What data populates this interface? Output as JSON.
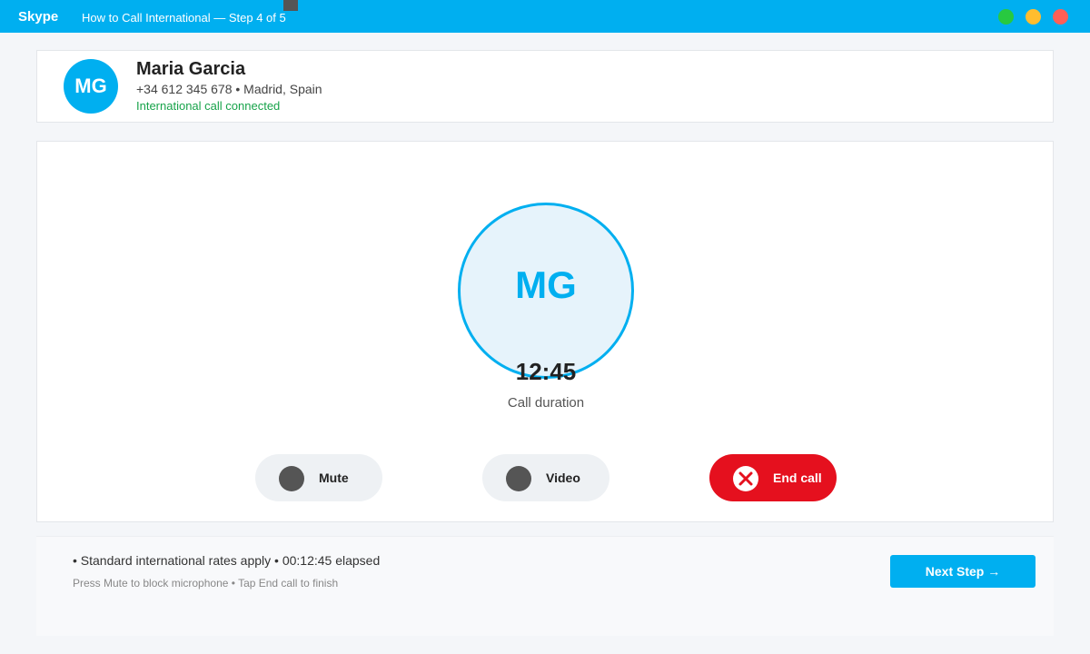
{
  "window": {
    "app_name": "Skype",
    "title": "How to Call International — Step 4 of 5"
  },
  "contact": {
    "initials": "MG",
    "name": "Maria Garcia",
    "phone_location": "+34 612 345 678 • Madrid, Spain",
    "status": "International call connected"
  },
  "call": {
    "initials": "MG",
    "duration": "12:45",
    "duration_label": "Call duration",
    "controls": {
      "mute_label": "Mute",
      "video_label": "Video",
      "end_label": "End call"
    }
  },
  "footer": {
    "info": "• Standard international rates apply • 00:12:45 elapsed",
    "hint": "Press Mute to block microphone • Tap End call to finish",
    "next_label": "Next Step →"
  },
  "colors": {
    "brand": "#00aff0",
    "end_call": "#e5101e",
    "connected": "#17a34a"
  },
  "icons": {
    "window_controls": [
      "maximize-icon",
      "minimize-icon",
      "close-icon"
    ],
    "end_call": "close-x-icon"
  }
}
